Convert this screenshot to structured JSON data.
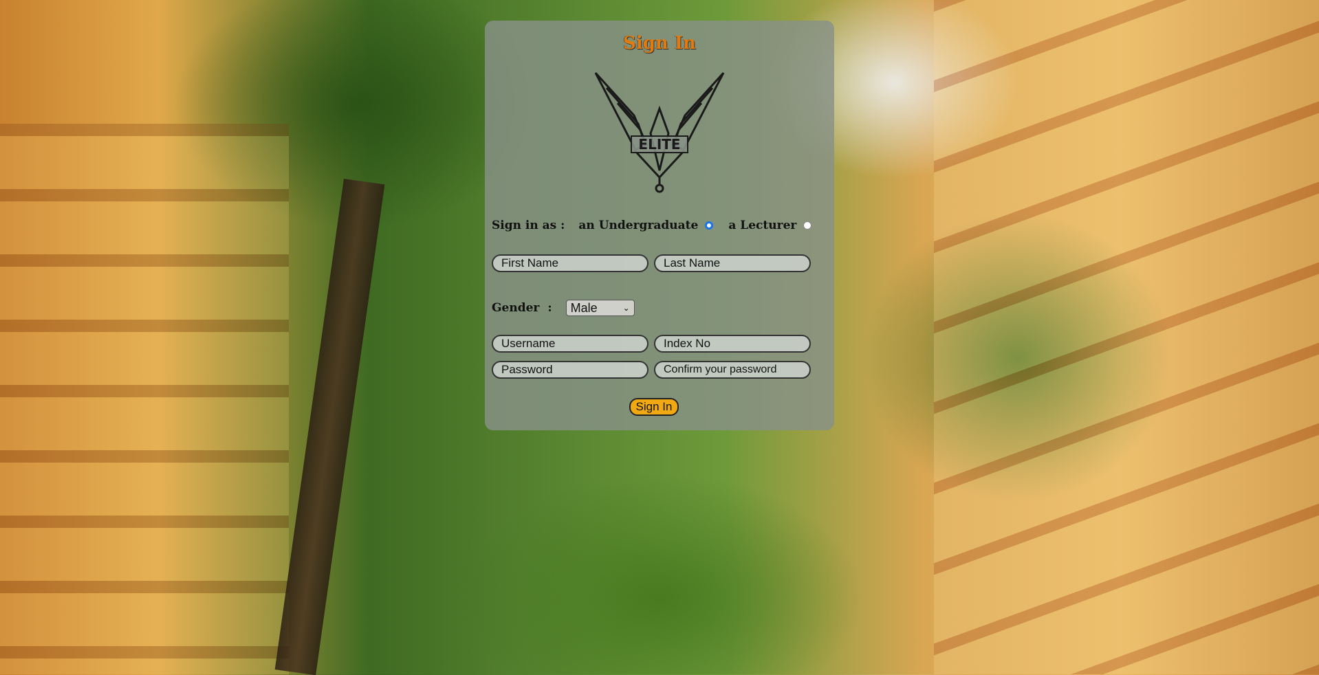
{
  "form": {
    "title": "Sign In",
    "logo_text": "ELITE",
    "sign_in_as_label": "Sign in as :",
    "roles": [
      {
        "label": "an Undergraduate",
        "selected": true
      },
      {
        "label": "a Lecturer",
        "selected": false
      }
    ],
    "first_name_placeholder": "First Name",
    "last_name_placeholder": "Last Name",
    "gender_label": "Gender",
    "gender_colon": ":",
    "gender_selected": "Male",
    "username_placeholder": "Username",
    "index_placeholder": "Index No",
    "password_placeholder": "Password",
    "confirm_password_placeholder": "Confirm your password",
    "submit_label": "Sign In"
  },
  "colors": {
    "title": "#e07b10",
    "button": "#f0a813",
    "radio_selected": "#1a73e8"
  }
}
